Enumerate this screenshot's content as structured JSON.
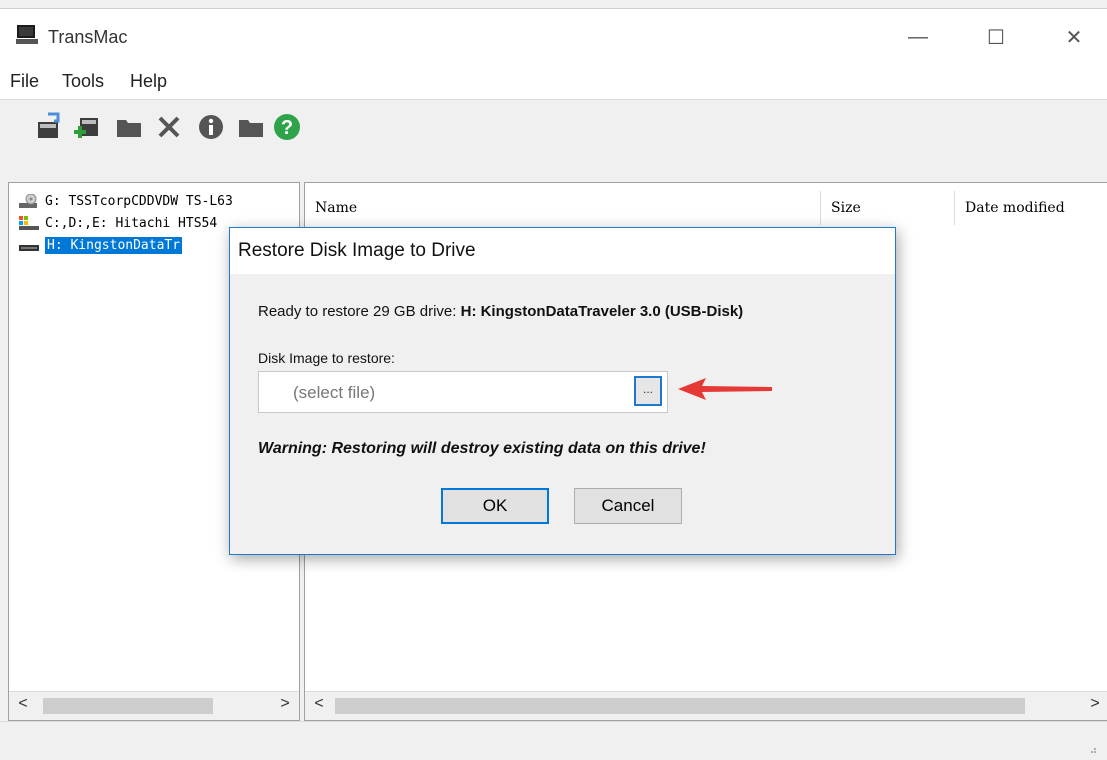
{
  "window": {
    "title": "TransMac",
    "controls": {
      "minimize": "—",
      "maximize": "☐",
      "close": "✕"
    }
  },
  "menu": {
    "items": [
      "File",
      "Tools",
      "Help"
    ]
  },
  "toolbar": {
    "buttons": [
      "open-disk-image-icon",
      "new-disk-image-icon",
      "folder-icon",
      "delete-icon",
      "info-icon",
      "folder-icon",
      "help-icon"
    ]
  },
  "drives": [
    {
      "label": "G: TSSTcorpCDDVDW TS-L63",
      "icon": "cd-drive-icon",
      "selected": false
    },
    {
      "label": "C:,D:,E: Hitachi HTS54",
      "icon": "windows-drive-icon",
      "selected": false
    },
    {
      "label": "H: KingstonDataTr",
      "icon": "usb-drive-icon",
      "selected": true
    }
  ],
  "file_list": {
    "columns": [
      "Name",
      "Size",
      "Date modified"
    ]
  },
  "scroll": {
    "left_arrow": "<",
    "right_arrow": ">"
  },
  "dialog": {
    "title": "Restore Disk Image to Drive",
    "message_prefix": "Ready to restore 29 GB drive: ",
    "message_drive": "H: KingstonDataTraveler 3.0 (USB-Disk)",
    "image_label": "Disk Image to restore:",
    "file_placeholder": "(select file)",
    "browse_label": "...",
    "warning": "Warning: Restoring will destroy existing data on this drive!",
    "ok_label": "OK",
    "cancel_label": "Cancel"
  },
  "colors": {
    "accent": "#0078d7",
    "arrow": "#e53935"
  }
}
